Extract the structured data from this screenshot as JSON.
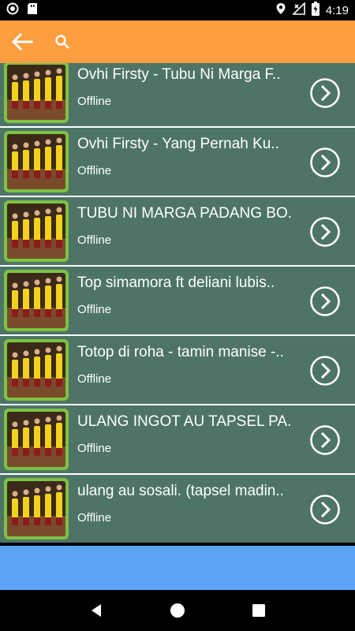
{
  "status_bar": {
    "time": "4:19",
    "icons": [
      "record-icon",
      "sd-card-icon",
      "location-icon",
      "no-signal-icon",
      "battery-charging-icon"
    ]
  },
  "toolbar": {
    "back_icon": "arrow-left-icon",
    "search_icon": "search-icon",
    "background": "#FF9E40"
  },
  "list": {
    "row_color": "#4E7466",
    "thumb_border": "#7DC242",
    "items": [
      {
        "title": "Ovhi Firsty - Tubu Ni Marga F..",
        "status": "Offline"
      },
      {
        "title": "Ovhi Firsty - Yang Pernah Ku..",
        "status": "Offline"
      },
      {
        "title": "TUBU NI MARGA PADANG BO..",
        "status": "Offline"
      },
      {
        "title": "Top simamora ft deliani lubis..",
        "status": "Offline"
      },
      {
        "title": "Totop di roha - tamin manise -..",
        "status": "Offline"
      },
      {
        "title": "ULANG INGOT AU TAPSEL PA..",
        "status": "Offline"
      },
      {
        "title": "ulang au sosali. (tapsel madin..",
        "status": "Offline"
      }
    ]
  },
  "banner": {
    "color": "#5BA3F5"
  },
  "nav_bar": {
    "icons": [
      "back-triangle-icon",
      "home-circle-icon",
      "recents-square-icon"
    ]
  }
}
